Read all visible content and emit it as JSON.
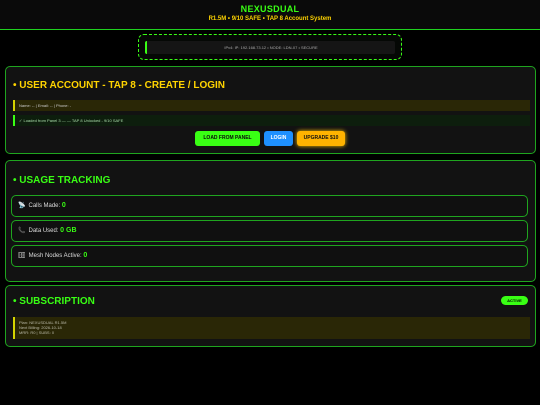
{
  "header": {
    "title": "NEXUSDUAL",
    "subtitle": "R1.5M • 9/10 SAFE • TAP 8 Account System"
  },
  "network_bar": {
    "text": "IPv4: IP: 192.168.73.12 • NODE: LDN-07 • SECURE"
  },
  "account": {
    "title": "• USER ACCOUNT - TAP 8 - CREATE / LOGIN",
    "info_line": "Name: -- | Email: -- | Phone: -",
    "status_line": "✓ Loaded from Panel 3 — — TAP 8 Unlocked - 9/10 SAFE",
    "buttons": {
      "load": "LOAD FROM PANEL",
      "login": "LOGIN",
      "upgrade": "UPGRADE $10"
    }
  },
  "usage": {
    "title": "• USAGE TRACKING",
    "metrics": [
      {
        "icon": "satellite-icon",
        "glyph": "📡",
        "label": "Calls Made:",
        "value": "0"
      },
      {
        "icon": "phone-icon",
        "glyph": "📞",
        "label": "Data Used:",
        "value": "0 GB"
      },
      {
        "icon": "server-icon",
        "glyph": "🗄",
        "label": "Mesh Nodes Active:",
        "value": "0"
      }
    ]
  },
  "subscription": {
    "title": "• SUBSCRIPTION",
    "status_badge": "ACTIVE",
    "lines": [
      "Plan: NEXUSDUAL R1.5M",
      "Next Billing: 2026-10-18",
      "MRR: R0 | SUBS: 0"
    ]
  },
  "colors": {
    "accent": "#39ff14",
    "title_yellow": "#ffd400",
    "login_blue": "#1e90ff",
    "upgrade_orange": "#ffb300"
  }
}
